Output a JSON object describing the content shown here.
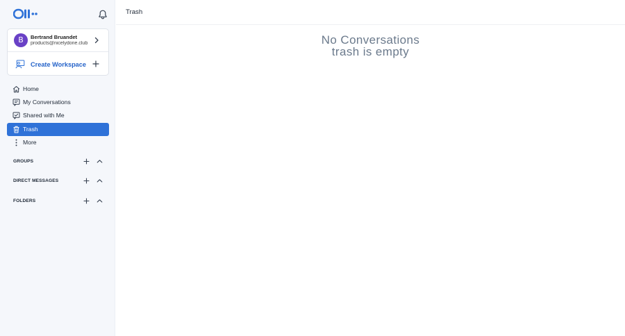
{
  "app": {
    "logo_text": "Olli"
  },
  "account": {
    "avatar_initial": "B",
    "name": "Bertrand Bruandet",
    "email": "products@nicelydone.club"
  },
  "workspace": {
    "create_label": "Create Workspace"
  },
  "nav": {
    "items": [
      {
        "label": "Home",
        "icon": "home-icon"
      },
      {
        "label": "My Conversations",
        "icon": "chat-icon"
      },
      {
        "label": "Shared with Me",
        "icon": "shared-icon"
      },
      {
        "label": "Trash",
        "icon": "trash-icon",
        "active": true
      },
      {
        "label": "More",
        "icon": "more-vertical-icon"
      }
    ]
  },
  "sections": {
    "groups": "GROUPS",
    "direct_messages": "DIRECT MESSAGES",
    "folders": "FOLDERS"
  },
  "header": {
    "title": "Trash"
  },
  "empty_state": {
    "line1": "No Conversations",
    "line2": "trash is empty"
  },
  "colors": {
    "accent": "#2f72d8",
    "avatar": "#6941c6",
    "sidebar_bg": "#f5f7fb"
  }
}
